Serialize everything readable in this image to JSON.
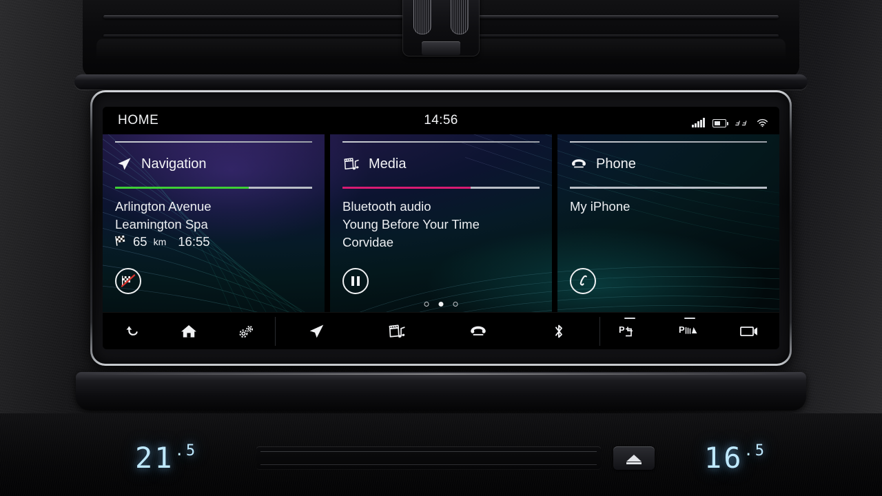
{
  "status_bar": {
    "screen_label": "HOME",
    "time": "14:56",
    "icons": [
      "signal-bars-icon",
      "battery-icon",
      "antenna-icon",
      "wifi-icon"
    ]
  },
  "tiles": [
    {
      "id": "navigation",
      "title": "Navigation",
      "icon": "navigation-arrow-icon",
      "accent_color": "#3fcf36",
      "accent_fill_percent": 68,
      "lines": [
        "Arlington Avenue",
        "Leamington Spa"
      ],
      "eta": {
        "flag_icon": "checkered-flag-icon",
        "distance": "65",
        "unit": "km",
        "arrival": "16:55"
      },
      "action": {
        "name": "cancel-route-button",
        "icon": "checkered-flag-cancel-icon"
      }
    },
    {
      "id": "media",
      "title": "Media",
      "icon": "media-clapperboard-note-icon",
      "accent_color": "#d81b72",
      "accent_fill_percent": 65,
      "lines": [
        "Bluetooth audio",
        "Young Before Your Time",
        "Corvidae"
      ],
      "action": {
        "name": "pause-button",
        "icon": "pause-icon"
      }
    },
    {
      "id": "phone",
      "title": "Phone",
      "icon": "phone-handset-icon",
      "accent_color": "#b9bec6",
      "accent_fill_percent": 0,
      "lines": [
        "My iPhone"
      ],
      "action": {
        "name": "call-button",
        "icon": "call-handset-icon"
      }
    }
  ],
  "pagination": {
    "total": 3,
    "active": 2
  },
  "toolbar": {
    "group_left": [
      {
        "name": "back-button",
        "icon": "back-arrow-icon"
      },
      {
        "name": "home-button",
        "icon": "home-icon"
      },
      {
        "name": "settings-button",
        "icon": "gears-icon"
      }
    ],
    "group_center": [
      {
        "name": "navigation-button",
        "icon": "navigation-arrow-icon"
      },
      {
        "name": "media-button",
        "icon": "media-clapperboard-note-icon"
      },
      {
        "name": "phone-button",
        "icon": "phone-handset-icon"
      },
      {
        "name": "bluetooth-button",
        "icon": "bluetooth-icon"
      }
    ],
    "group_right": [
      {
        "name": "park-assist-button",
        "icon": "park-assist-icon",
        "indicator": true
      },
      {
        "name": "parking-sensors-button",
        "icon": "parking-sensor-icon",
        "indicator": true
      },
      {
        "name": "camera-button",
        "icon": "camera-icon",
        "indicator": false
      }
    ]
  },
  "climate": {
    "left_temperature": "21",
    "left_decimal": ".5",
    "right_temperature": "16",
    "right_decimal": ".5",
    "eject_label": "eject-icon"
  }
}
